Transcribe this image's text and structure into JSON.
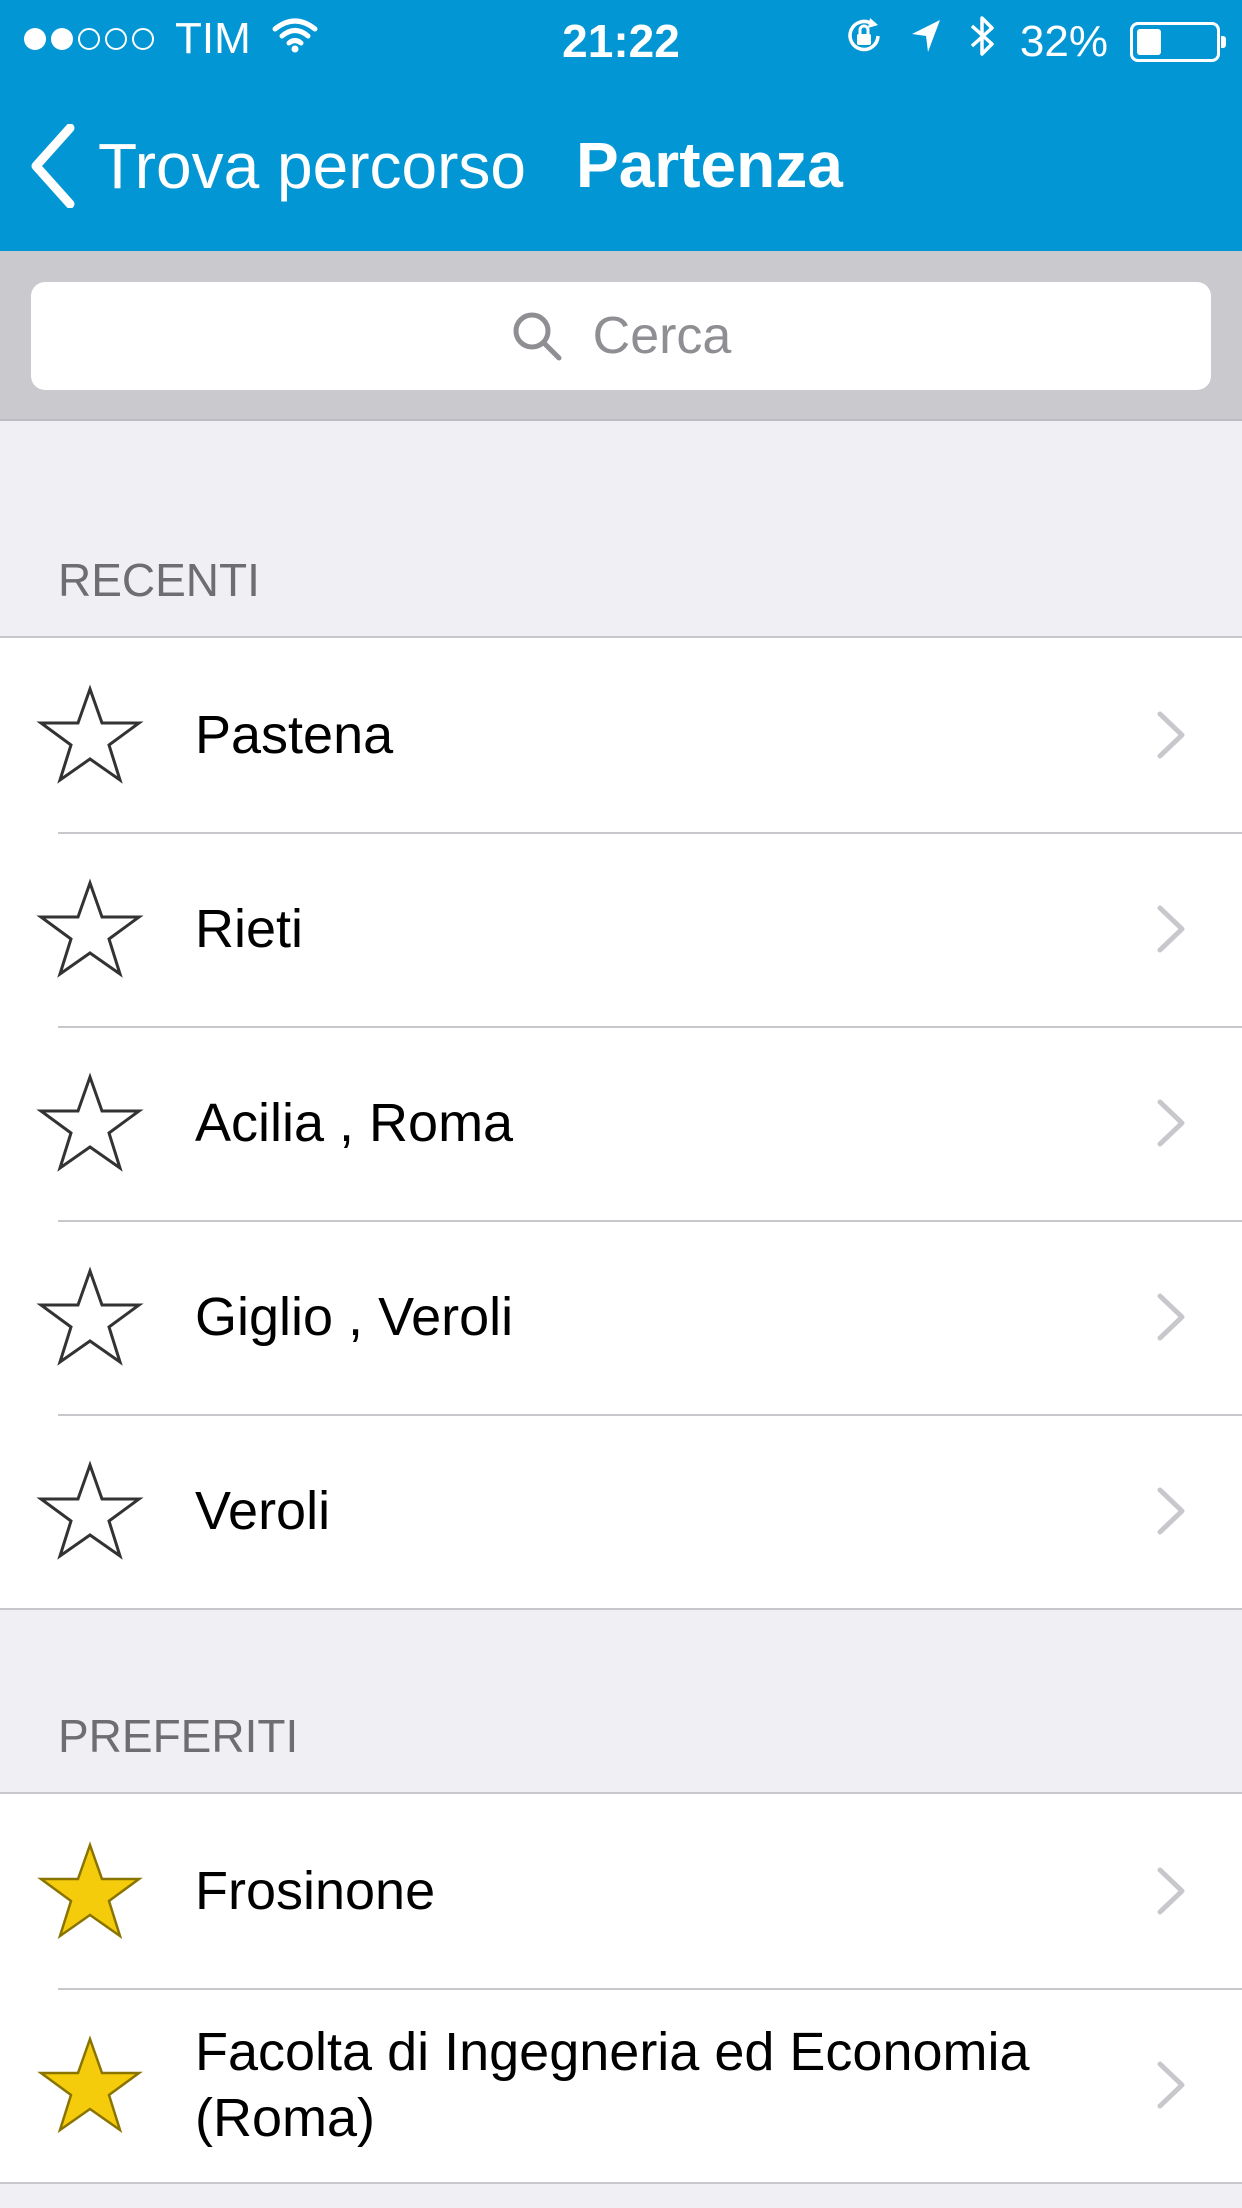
{
  "status_bar": {
    "carrier": "TIM",
    "time": "21:22",
    "battery": "32%",
    "battery_level": 0.32,
    "signal_bars": 2,
    "icons": [
      "wifi-icon",
      "rotation-lock-icon",
      "location-arrow-icon",
      "bluetooth-icon",
      "battery-icon"
    ]
  },
  "nav": {
    "back_label": "Trova percorso",
    "title": "Partenza"
  },
  "search": {
    "placeholder": "Cerca"
  },
  "sections": {
    "recent": {
      "header": "RECENTI",
      "items": [
        {
          "label": "Pastena",
          "favorite": false
        },
        {
          "label": "Rieti",
          "favorite": false
        },
        {
          "label": "Acilia , Roma",
          "favorite": false
        },
        {
          "label": "Giglio , Veroli",
          "favorite": false
        },
        {
          "label": "Veroli",
          "favorite": false
        }
      ]
    },
    "favorites": {
      "header": "PREFERITI",
      "items": [
        {
          "label": "Frosinone",
          "favorite": true
        },
        {
          "label": "Facolta di Ingegneria ed Economia (Roma)",
          "favorite": true
        }
      ]
    }
  },
  "colors": {
    "nav_blue": "#0396d4",
    "star_gold": "#f5cc0c",
    "background": "#efeff4"
  }
}
